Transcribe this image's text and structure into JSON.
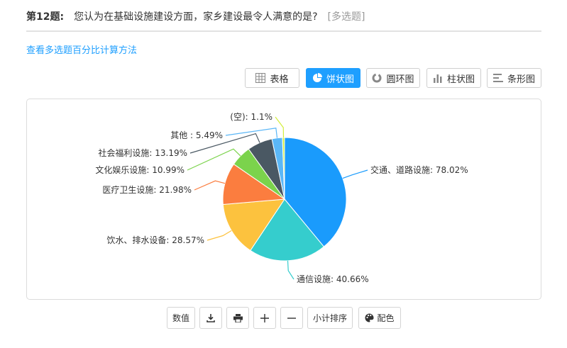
{
  "question": {
    "number": "第12题:",
    "text": "您认为在基础设施建设方面，家乡建设最令人满意的是?",
    "type": "[多选题]"
  },
  "method_link": "查看多选题百分比计算方法",
  "tabs": [
    {
      "label": "表格",
      "icon": "table-icon",
      "active": false
    },
    {
      "label": "饼状图",
      "icon": "pie-chart-icon",
      "active": true
    },
    {
      "label": "圆环图",
      "icon": "donut-chart-icon",
      "active": false
    },
    {
      "label": "柱状图",
      "icon": "bar-chart-icon",
      "active": false
    },
    {
      "label": "条形图",
      "icon": "horizontal-bar-icon",
      "active": false
    }
  ],
  "chart_data": {
    "type": "pie",
    "series": [
      {
        "name": "交通、道路设施",
        "value": 78.02,
        "label": "交通、道路设施: 78.02%",
        "color": "#1a9bfc"
      },
      {
        "name": "通信设施",
        "value": 40.66,
        "label": "通信设施: 40.66%",
        "color": "#35cdcd"
      },
      {
        "name": "饮水、排水设备",
        "value": 28.57,
        "label": "饮水、排水设备: 28.57%",
        "color": "#fcc23e"
      },
      {
        "name": "医疗卫生设施",
        "value": 21.98,
        "label": "医疗卫生设施: 21.98%",
        "color": "#fb7d3f"
      },
      {
        "name": "文化娱乐设施",
        "value": 10.99,
        "label": "文化娱乐设施: 10.99%",
        "color": "#7bd34c"
      },
      {
        "name": "社会福利设施",
        "value": 13.19,
        "label": "社会福利设施: 13.19%",
        "color": "#4a5863"
      },
      {
        "name": "其他",
        "value": 5.49,
        "label": "其他 : 5.49%",
        "color": "#5bb7f7"
      },
      {
        "name": "(空)",
        "value": 1.1,
        "label": "(空): 1.1%",
        "color": "#d3ee3c"
      }
    ]
  },
  "bottom_buttons": [
    {
      "label": "数值",
      "icon": ""
    },
    {
      "label": "",
      "icon": "download-icon"
    },
    {
      "label": "",
      "icon": "print-icon"
    },
    {
      "label": "",
      "icon": "plus-icon"
    },
    {
      "label": "",
      "icon": "minus-icon"
    },
    {
      "label": "小计排序",
      "icon": ""
    },
    {
      "label": "配色",
      "icon": "palette-icon"
    }
  ]
}
